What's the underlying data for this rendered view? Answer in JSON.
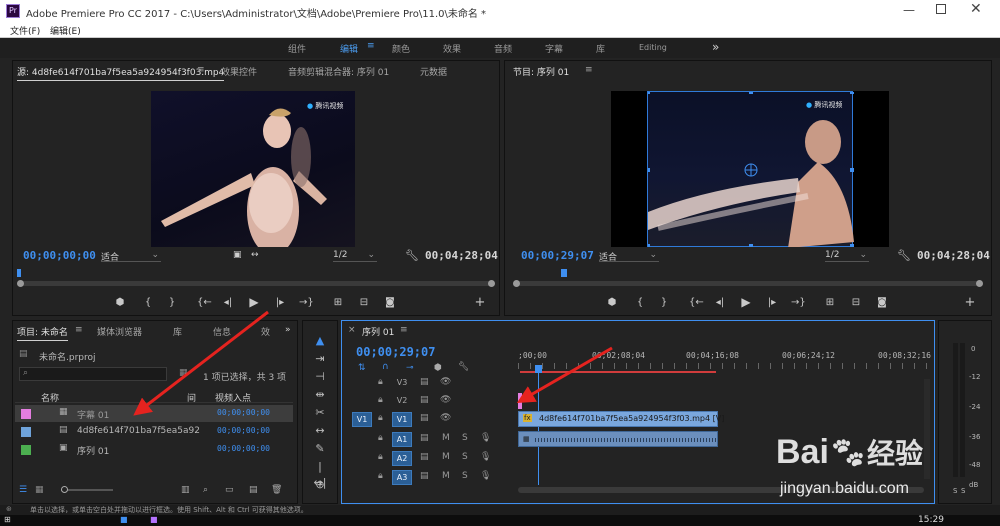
{
  "window": {
    "title": "Adobe Premiere Pro CC 2017 - C:\\Users\\Administrator\\文档\\Adobe\\Premiere Pro\\11.0\\未命名 *"
  },
  "menu": {
    "file": "文件(F)",
    "edit": "编辑(E)"
  },
  "workspaces": {
    "items": [
      "组件",
      "编辑",
      "颜色",
      "效果",
      "音频",
      "字幕",
      "库",
      "Editing"
    ],
    "active": "编辑",
    "more": "»"
  },
  "source_monitor": {
    "tabs": [
      "源: 4d8fe614f701ba7f5ea5a924954f3f03.mp4",
      "效果控件",
      "音频剪辑混合器: 序列 01",
      "元数据"
    ],
    "watermark": "腾讯视频",
    "timecode": "00;00;00;00",
    "fit": "适合",
    "resolution": "1/2",
    "duration": "00;04;28;04"
  },
  "program_monitor": {
    "tab": "节目: 序列 01",
    "watermark": "腾讯视频",
    "timecode": "00;00;29;07",
    "fit": "适合",
    "resolution": "1/2",
    "duration": "00;04;28;04"
  },
  "project": {
    "tabs": [
      "项目: 未命名",
      "媒体浏览器",
      "库",
      "信息",
      "效"
    ],
    "file": "未命名.prproj",
    "selection": "1 项已选择，共 3 项",
    "col_name": "名称",
    "col_fps": "间",
    "col_in": "视频入点",
    "items": [
      {
        "name": "字幕 01",
        "in": "00;00;00;00",
        "color": "#e47de0"
      },
      {
        "name": "4d8fe614f701ba7f5ea5a92",
        "in": "00;00;00;00",
        "color": "#6fa3db"
      },
      {
        "name": "序列 01",
        "in": "00;00;00;00",
        "color": "#4caf50"
      }
    ]
  },
  "timeline": {
    "tab": "序列 01",
    "timecode": "00;00;29;07",
    "ruler": [
      ";00;00",
      "00;02;08;04",
      "00;04;16;08",
      "00;06;24;12",
      "00;08;32;16"
    ],
    "tracks": [
      {
        "id": "V3",
        "target": ""
      },
      {
        "id": "V2",
        "target": ""
      },
      {
        "id": "V1",
        "target": "V1"
      },
      {
        "id": "A1",
        "target": ""
      },
      {
        "id": "A2",
        "target": ""
      },
      {
        "id": "A3",
        "target": ""
      }
    ],
    "clip_label": "4d8fe614f701ba7f5ea5a924954f3f03.mp4 [V]",
    "fx": "fx"
  },
  "meter": {
    "scale": [
      "0",
      "-12",
      "-24",
      "-36",
      "-48",
      "dB"
    ],
    "solo": "S"
  },
  "status": {
    "text": "单击以选择，或单击空白处并拖动以进行框选。使用 Shift、Alt 和 Ctrl 可获得其他选项。"
  },
  "taskbar": {
    "time": "15:29"
  },
  "watermark_baidu": {
    "brand": "Bai",
    "brand2": "经验",
    "url": "jingyan.baidu.com"
  }
}
